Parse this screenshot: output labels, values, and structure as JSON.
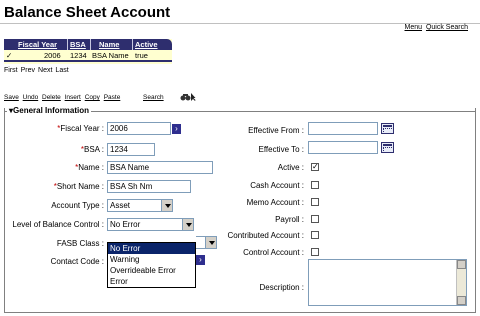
{
  "page": {
    "title": "Balance Sheet Account"
  },
  "top_links": {
    "menu": "Menu",
    "quick_search": "Quick Search"
  },
  "grid": {
    "headers": [
      "Fiscal Year",
      "BSA",
      "Name",
      "Active"
    ],
    "row": {
      "check": "✓",
      "fiscal_year": "2006",
      "bsa": "1234",
      "name": "BSA Name",
      "active": "true"
    },
    "colors": {
      "header_bg": "#2e2e6e",
      "row_bg": "#ffffd0"
    }
  },
  "pager": {
    "first": "First",
    "prev": "Prev",
    "next": "Next",
    "last": "Last"
  },
  "toolbar": {
    "items": [
      "Save",
      "Undo",
      "Delete",
      "Insert",
      "Copy",
      "Paste"
    ],
    "search": "Search",
    "icons": [
      "binoculars-icon",
      "cursor-icon"
    ]
  },
  "section": {
    "title": "General Information",
    "collapse_icon": "triangle-down-icon"
  },
  "form": {
    "fiscal_year": {
      "label": "Fiscal Year :",
      "value": "2006",
      "required": "*"
    },
    "bsa": {
      "label": "BSA :",
      "value": "1234",
      "required": "*"
    },
    "name": {
      "label": "Name :",
      "value": "BSA Name",
      "required": "*"
    },
    "short_name": {
      "label": "Short Name :",
      "value": "BSA Sh Nm",
      "required": "*"
    },
    "account_type": {
      "label": "Account Type :",
      "value": "Asset"
    },
    "level_of_balance_control": {
      "label": "Level of Balance Control :",
      "value": "No Error",
      "options": [
        "No Error",
        "Warning",
        "Overrideable Error",
        "Error"
      ]
    },
    "fasb_class": {
      "label": "FASB Class :"
    },
    "contact_code": {
      "label": "Contact Code :"
    },
    "effective_from": {
      "label": "Effective From :",
      "value": ""
    },
    "effective_to": {
      "label": "Effective To :",
      "value": ""
    },
    "active": {
      "label": "Active :",
      "checked": "✓"
    },
    "cash_account": {
      "label": "Cash Account :"
    },
    "memo_account": {
      "label": "Memo Account :"
    },
    "payroll": {
      "label": "Payroll :"
    },
    "contributed_account": {
      "label": "Contributed Account :"
    },
    "control_account": {
      "label": "Control Account :"
    },
    "description": {
      "label": "Description :",
      "value": ""
    }
  },
  "colors": {
    "accent": "#2e2e6e",
    "required": "#c00000",
    "selection": "#0a246a"
  }
}
